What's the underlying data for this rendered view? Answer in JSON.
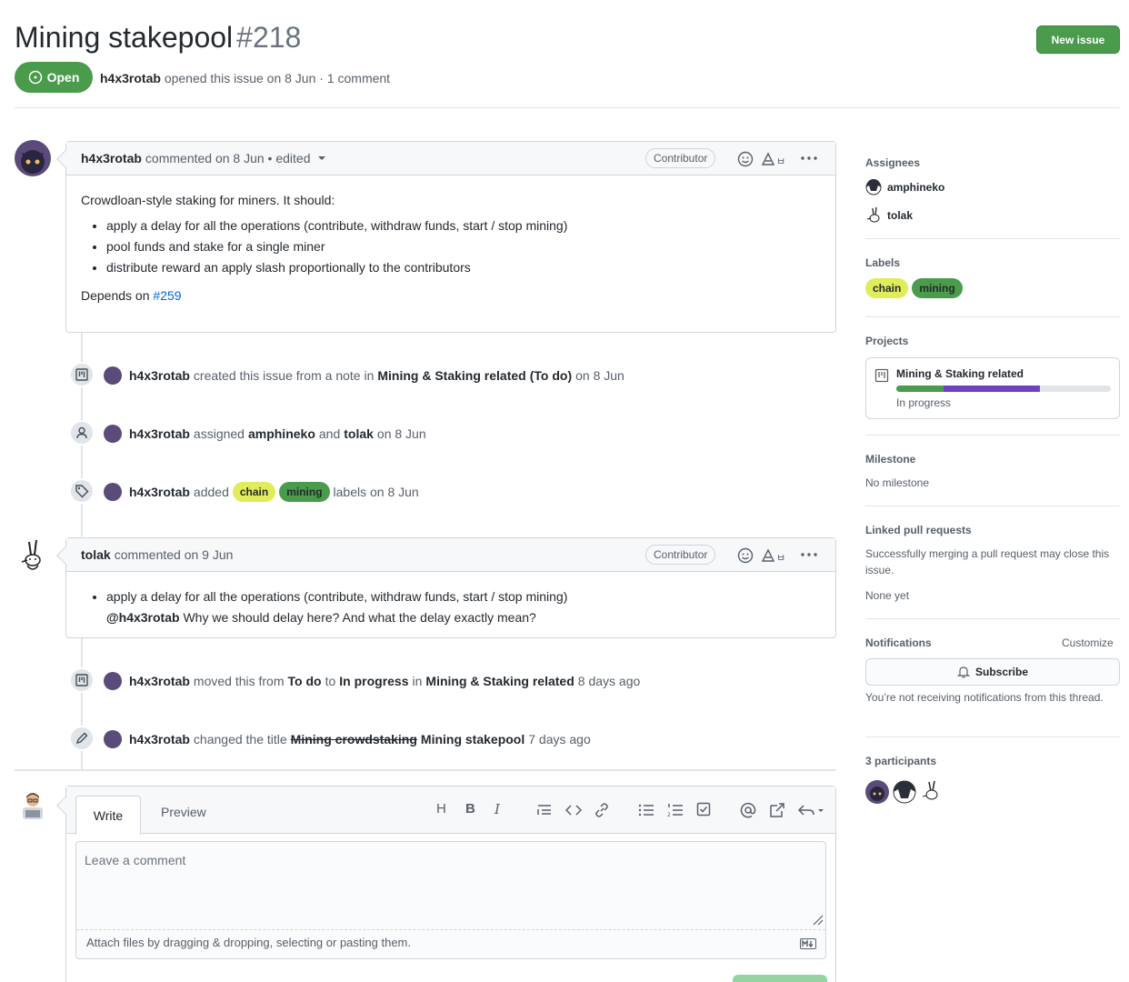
{
  "issue": {
    "title": "Mining stakepool",
    "number": "#218",
    "status": "Open",
    "author": "h4x3rotab",
    "opened_text": "opened this issue on 8 Jun · 1 comment",
    "new_issue_label": "New issue"
  },
  "comment1": {
    "author": "h4x3rotab",
    "meta": "commented on 8 Jun • edited",
    "role": "Contributor",
    "intro": "Crowdloan-style staking for miners. It should:",
    "bullets": [
      "apply a delay for all the operations (contribute, withdraw funds, start / stop mining)",
      "pool funds and stake for a single miner",
      "distribute reward an apply slash proportionally to the contributors"
    ],
    "depends_prefix": "Depends on",
    "depends_link": "#259"
  },
  "events": {
    "e1": {
      "actor": "h4x3rotab",
      "t1": "created this issue from a note in",
      "project": "Mining & Staking related",
      "column": "(To do)",
      "t2": "on 8 Jun"
    },
    "e2": {
      "actor": "h4x3rotab",
      "t1": "assigned",
      "a1": "amphineko",
      "and": "and",
      "a2": "tolak",
      "t2": "on 8 Jun"
    },
    "e3": {
      "actor": "h4x3rotab",
      "t1": "added",
      "l1": "chain",
      "l2": "mining",
      "t2": "labels on 8 Jun"
    },
    "e4": {
      "actor": "h4x3rotab",
      "t1": "moved this from",
      "from": "To do",
      "to_word": "to",
      "to": "In progress",
      "in_word": "in",
      "project": "Mining & Staking related",
      "t2": "8 days ago"
    },
    "e5": {
      "actor": "h4x3rotab",
      "t1": "changed the title",
      "old": "Mining crowdstaking",
      "new": "Mining stakepool",
      "t2": "7 days ago"
    }
  },
  "comment2": {
    "author": "tolak",
    "meta": "commented on 9 Jun",
    "role": "Contributor",
    "quote": "apply a delay for all the operations (contribute, withdraw funds, start / stop mining)",
    "mention": "@h4x3rotab",
    "reply": "Why we should delay here? And what the delay exactly mean?"
  },
  "editor": {
    "tab_write": "Write",
    "tab_preview": "Preview",
    "placeholder": "Leave a comment",
    "attach": "Attach files by dragging & dropping, selecting or pasting them."
  },
  "sidebar": {
    "assignees_h": "Assignees",
    "assignees": [
      "amphineko",
      "tolak"
    ],
    "labels_h": "Labels",
    "labels": [
      "chain",
      "mining"
    ],
    "projects_h": "Projects",
    "project_name": "Mining & Staking related",
    "project_status": "In progress",
    "project_progress": {
      "done_pct": 22,
      "in_progress_pct": 45
    },
    "milestone_h": "Milestone",
    "milestone": "No milestone",
    "linked_h": "Linked pull requests",
    "linked_desc": "Successfully merging a pull request may close this issue.",
    "linked_none": "None yet",
    "notif_h": "Notifications",
    "customize": "Customize",
    "subscribe": "Subscribe",
    "notif_desc": "You’re not receiving notifications from this thread.",
    "participants_h": "3 participants"
  },
  "colors": {
    "green": "#4a9b4b",
    "chain": "#e1ec5a",
    "progress_done": "#4a9b4b",
    "progress_inprog": "#6f42c1"
  }
}
